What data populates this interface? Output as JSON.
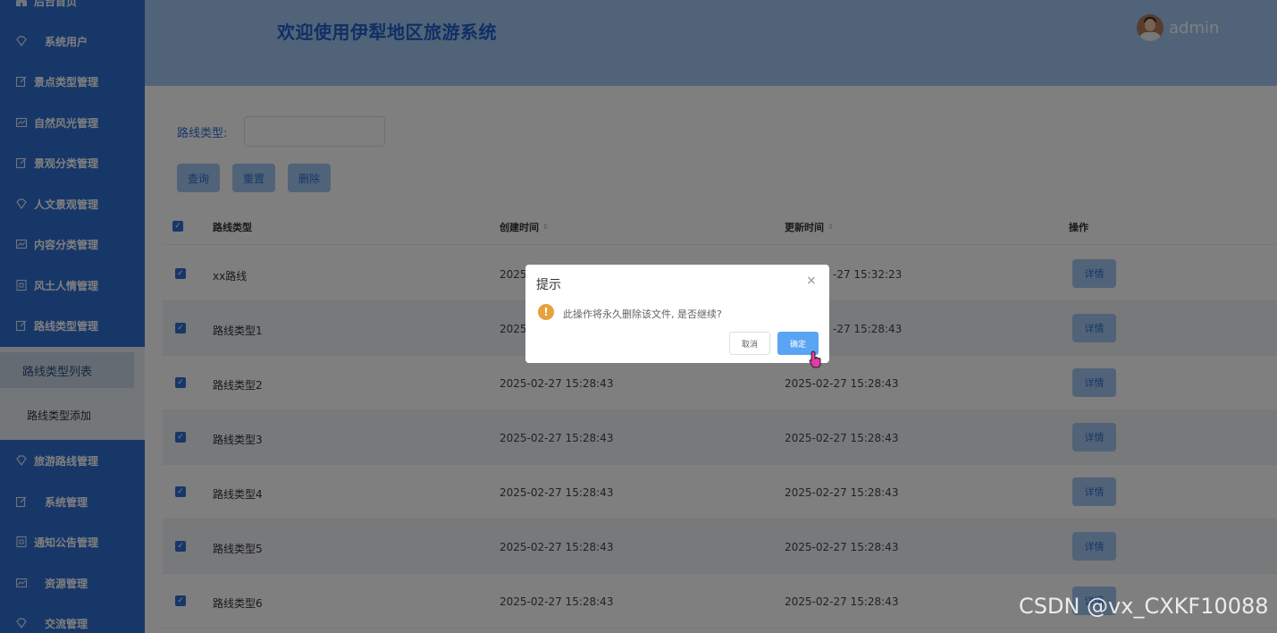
{
  "header": {
    "title": "欢迎使用伊犁地区旅游系统",
    "username": "admin"
  },
  "sidebar": {
    "items": [
      {
        "label": "后台首页",
        "icon": "home-icon"
      },
      {
        "label": "系统用户",
        "icon": "diamond-icon"
      },
      {
        "label": "景点类型管理",
        "icon": "edit-icon"
      },
      {
        "label": "自然风光管理",
        "icon": "chart-icon"
      },
      {
        "label": "景观分类管理",
        "icon": "edit-icon"
      },
      {
        "label": "人文景观管理",
        "icon": "diamond-icon"
      },
      {
        "label": "内容分类管理",
        "icon": "chart-icon"
      },
      {
        "label": "风土人情管理",
        "icon": "doc-icon"
      },
      {
        "label": "路线类型管理",
        "icon": "edit-icon"
      },
      {
        "label": "旅游路线管理",
        "icon": "diamond-icon"
      },
      {
        "label": "系统管理",
        "icon": "edit-icon"
      },
      {
        "label": "通知公告管理",
        "icon": "doc-icon"
      },
      {
        "label": "资源管理",
        "icon": "chart-icon"
      },
      {
        "label": "交流管理",
        "icon": "diamond-icon"
      }
    ],
    "submenu": [
      {
        "label": "路线类型列表"
      },
      {
        "label": "路线类型添加"
      }
    ]
  },
  "filter": {
    "label": "路线类型:",
    "value": ""
  },
  "actions": {
    "query": "查询",
    "reset": "重置",
    "delete": "删除"
  },
  "table": {
    "headers": {
      "type": "路线类型",
      "created": "创建时间",
      "updated": "更新时间",
      "ops": "操作"
    },
    "detail_label": "详情",
    "rows": [
      {
        "type": "xx路线",
        "created": "2025",
        "updated": "-27 15:32:23"
      },
      {
        "type": "路线类型1",
        "created": "2025",
        "updated": "-27 15:28:43"
      },
      {
        "type": "路线类型2",
        "created": "2025-02-27 15:28:43",
        "updated": "2025-02-27 15:28:43"
      },
      {
        "type": "路线类型3",
        "created": "2025-02-27 15:28:43",
        "updated": "2025-02-27 15:28:43"
      },
      {
        "type": "路线类型4",
        "created": "2025-02-27 15:28:43",
        "updated": "2025-02-27 15:28:43"
      },
      {
        "type": "路线类型5",
        "created": "2025-02-27 15:28:43",
        "updated": "2025-02-27 15:28:43"
      },
      {
        "type": "路线类型6",
        "created": "2025-02-27 15:28:43",
        "updated": "2025-02-27 15:28:43"
      }
    ]
  },
  "dialog": {
    "title": "提示",
    "message": "此操作将永久删除该文件, 是否继续?",
    "cancel": "取消",
    "confirm": "确定",
    "warn_glyph": "!",
    "close_glyph": "×"
  },
  "watermark": "CSDN @vx_CXKF10088",
  "colors": {
    "primary": "#2f6fd1",
    "header": "#a2c7f0",
    "warning": "#e6a23c"
  }
}
